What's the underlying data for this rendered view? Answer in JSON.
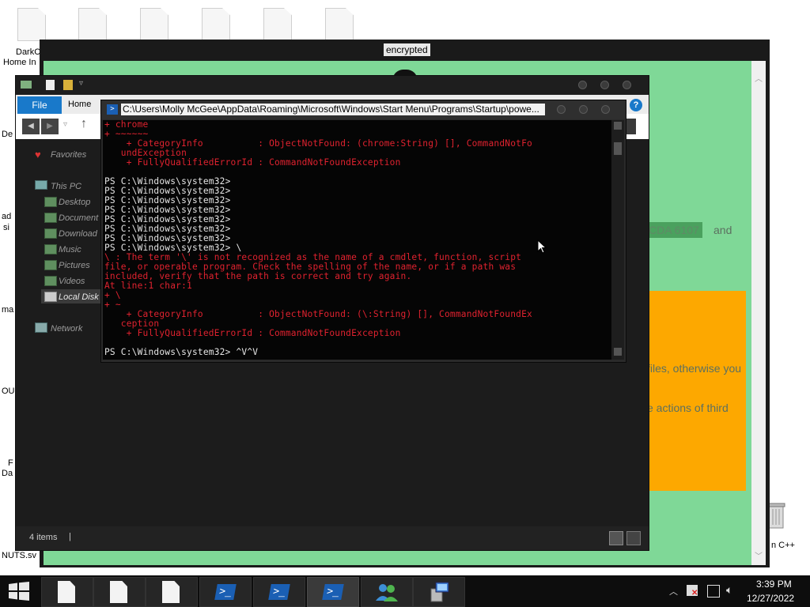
{
  "desktop": {
    "icons": [
      {
        "label": "DarkC",
        "sub": "Home In"
      },
      {
        "label": "De"
      },
      {
        "label": "ad",
        "sub": "si"
      },
      {
        "label": "ma"
      },
      {
        "label": "OU"
      },
      {
        "label": "F",
        "sub": "Da"
      },
      {
        "label": "NUTS.sv"
      },
      {
        "label": "n C++"
      }
    ],
    "top_icons": 6
  },
  "browser_window": {
    "title": "encrypted",
    "visible_text": {
      "code_fragment": "CDA 6107",
      "and": "and",
      "line1": "files, otherwise you",
      "line2": "e actions of third"
    }
  },
  "explorer": {
    "ribbon": {
      "file_tab": "File",
      "home_tab": "Home"
    },
    "nav": {
      "favorites": "Favorites",
      "this_pc": "This PC",
      "items": [
        "Desktop",
        "Document",
        "Download",
        "Music",
        "Pictures",
        "Videos",
        "Local Disk"
      ],
      "network": "Network"
    },
    "status": {
      "item_count": "4 items",
      "separator": "|"
    },
    "help_icon": "?"
  },
  "powershell": {
    "title_path": "C:\\Users\\Molly McGee\\AppData\\Roaming\\Microsoft\\Windows\\Start Menu\\Programs\\Startup\\powe...",
    "lines": [
      {
        "t": "+ chrome",
        "c": "red"
      },
      {
        "t": "+ ~~~~~~",
        "c": "red"
      },
      {
        "t": "    + CategoryInfo          : ObjectNotFound: (chrome:String) [], CommandNotFo",
        "c": "red"
      },
      {
        "t": "   undException",
        "c": "red"
      },
      {
        "t": "    + FullyQualifiedErrorId : CommandNotFoundException",
        "c": "red"
      },
      {
        "t": "",
        "c": "white"
      },
      {
        "t": "PS C:\\Windows\\system32>",
        "c": "white"
      },
      {
        "t": "PS C:\\Windows\\system32>",
        "c": "white"
      },
      {
        "t": "PS C:\\Windows\\system32>",
        "c": "white"
      },
      {
        "t": "PS C:\\Windows\\system32>",
        "c": "white"
      },
      {
        "t": "PS C:\\Windows\\system32>",
        "c": "white"
      },
      {
        "t": "PS C:\\Windows\\system32>",
        "c": "white"
      },
      {
        "t": "PS C:\\Windows\\system32>",
        "c": "white"
      },
      {
        "t": "PS C:\\Windows\\system32> \\",
        "c": "white"
      },
      {
        "t": "\\ : The term '\\' is not recognized as the name of a cmdlet, function, script",
        "c": "red"
      },
      {
        "t": "file, or operable program. Check the spelling of the name, or if a path was",
        "c": "red"
      },
      {
        "t": "included, verify that the path is correct and try again.",
        "c": "red"
      },
      {
        "t": "At line:1 char:1",
        "c": "red"
      },
      {
        "t": "+ \\",
        "c": "red"
      },
      {
        "t": "+ ~",
        "c": "red"
      },
      {
        "t": "    + CategoryInfo          : ObjectNotFound: (\\:String) [], CommandNotFoundEx",
        "c": "red"
      },
      {
        "t": "   ception",
        "c": "red"
      },
      {
        "t": "    + FullyQualifiedErrorId : CommandNotFoundException",
        "c": "red"
      },
      {
        "t": "",
        "c": "white"
      },
      {
        "t": "PS C:\\Windows\\system32> ^V^V",
        "c": "white"
      }
    ]
  },
  "taskbar": {
    "time": "3:39 PM",
    "date": "12/27/2022",
    "buttons": [
      "start",
      "file",
      "file",
      "file",
      "powershell",
      "powershell",
      "powershell",
      "network-users",
      "installer"
    ]
  },
  "colors": {
    "console_bg": "#050505",
    "error_red": "#e0222f",
    "browser_green": "#7fd897",
    "orange_panel": "#fda800",
    "file_tab_blue": "#1979ca"
  }
}
